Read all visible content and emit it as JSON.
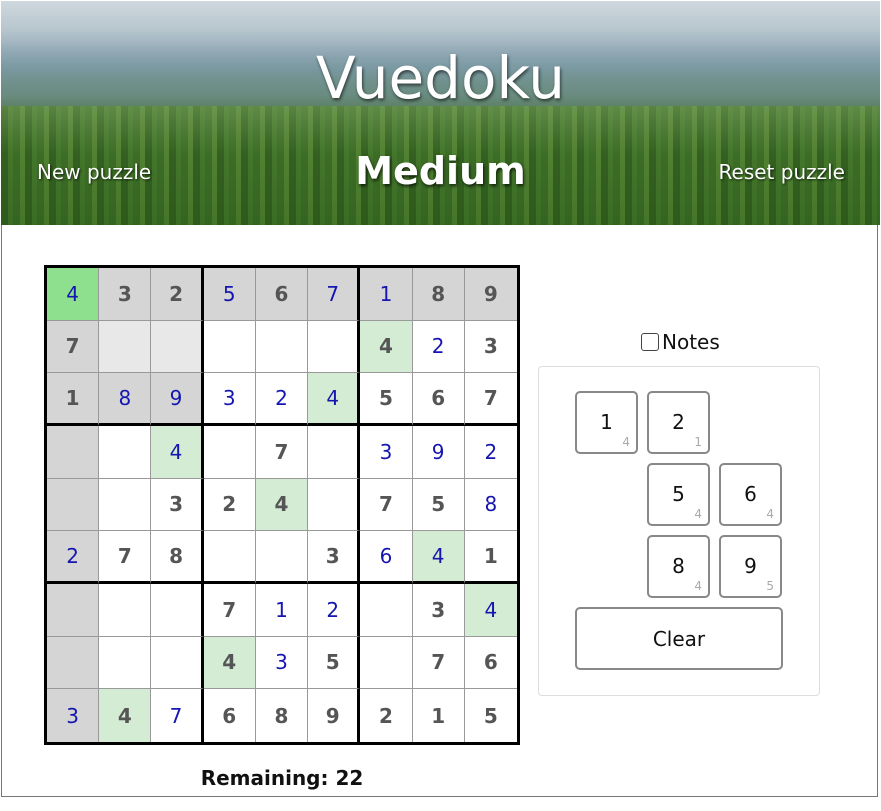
{
  "header": {
    "title": "Vuedoku",
    "difficulty": "Medium",
    "new_puzzle": "New puzzle",
    "reset_puzzle": "Reset puzzle"
  },
  "board": {
    "rows": [
      [
        "4",
        "3",
        "2",
        "5",
        "6",
        "7",
        "1",
        "8",
        "9"
      ],
      [
        "7",
        "",
        "",
        "",
        "",
        "",
        "4",
        "2",
        "3"
      ],
      [
        "1",
        "8",
        "9",
        "3",
        "2",
        "4",
        "5",
        "6",
        "7"
      ],
      [
        "",
        "",
        "4",
        "",
        "7",
        "",
        "3",
        "9",
        "2"
      ],
      [
        "",
        "",
        "3",
        "2",
        "4",
        "",
        "7",
        "5",
        "8"
      ],
      [
        "2",
        "7",
        "8",
        "",
        "",
        "3",
        "6",
        "4",
        "1"
      ],
      [
        "",
        "",
        "",
        "7",
        "1",
        "2",
        "",
        "3",
        "4"
      ],
      [
        "",
        "",
        "",
        "4",
        "3",
        "5",
        "",
        "7",
        "6"
      ],
      [
        "3",
        "4",
        "7",
        "6",
        "8",
        "9",
        "2",
        "1",
        "5"
      ]
    ],
    "kinds": [
      [
        "u",
        "g",
        "g",
        "u",
        "g",
        "u",
        "u",
        "g",
        "g"
      ],
      [
        "g",
        "",
        "",
        "",
        "",
        "",
        "g",
        "u",
        "g"
      ],
      [
        "g",
        "u",
        "u",
        "u",
        "u",
        "u",
        "g",
        "g",
        "g"
      ],
      [
        "",
        "",
        "u",
        "",
        "g",
        "",
        "u",
        "u",
        "u"
      ],
      [
        "",
        "",
        "g",
        "g",
        "g",
        "",
        "g",
        "g",
        "u"
      ],
      [
        "u",
        "g",
        "g",
        "",
        "",
        "g",
        "u",
        "u",
        "g"
      ],
      [
        "",
        "",
        "",
        "g",
        "u",
        "u",
        "",
        "g",
        "u"
      ],
      [
        "",
        "",
        "",
        "g",
        "u",
        "g",
        "",
        "g",
        "g"
      ],
      [
        "u",
        "g",
        "u",
        "g",
        "g",
        "g",
        "g",
        "g",
        "g"
      ]
    ],
    "shades": [
      [
        "sel",
        "hl",
        "hl",
        "hl",
        "hl",
        "hl",
        "hl",
        "hl",
        "hl"
      ],
      [
        "hl",
        "hl2",
        "hl2",
        "",
        "",
        "",
        "same",
        "",
        ""
      ],
      [
        "hl",
        "hl",
        "hl",
        "",
        "",
        "same",
        "",
        "",
        ""
      ],
      [
        "hl",
        "",
        "same",
        "",
        "",
        "",
        "",
        "",
        ""
      ],
      [
        "hl",
        "",
        "",
        "",
        "same",
        "",
        "",
        "",
        ""
      ],
      [
        "hl",
        "",
        "",
        "",
        "",
        "",
        "",
        "same",
        ""
      ],
      [
        "hl",
        "",
        "",
        "",
        "",
        "",
        "",
        "",
        "same"
      ],
      [
        "hl",
        "",
        "",
        "same",
        "",
        "",
        "",
        "",
        ""
      ],
      [
        "hl",
        "same",
        "",
        "",
        "",
        "",
        "",
        "",
        ""
      ]
    ],
    "remaining_label": "Remaining: 22"
  },
  "controls": {
    "notes_label": "Notes",
    "notes_checked": false,
    "keypad": [
      {
        "number": "1",
        "count": "4"
      },
      {
        "number": "2",
        "count": "1"
      },
      {
        "number": "5",
        "count": "4"
      },
      {
        "number": "6",
        "count": "4"
      },
      {
        "number": "8",
        "count": "4"
      },
      {
        "number": "9",
        "count": "5"
      }
    ],
    "clear_label": "Clear"
  }
}
